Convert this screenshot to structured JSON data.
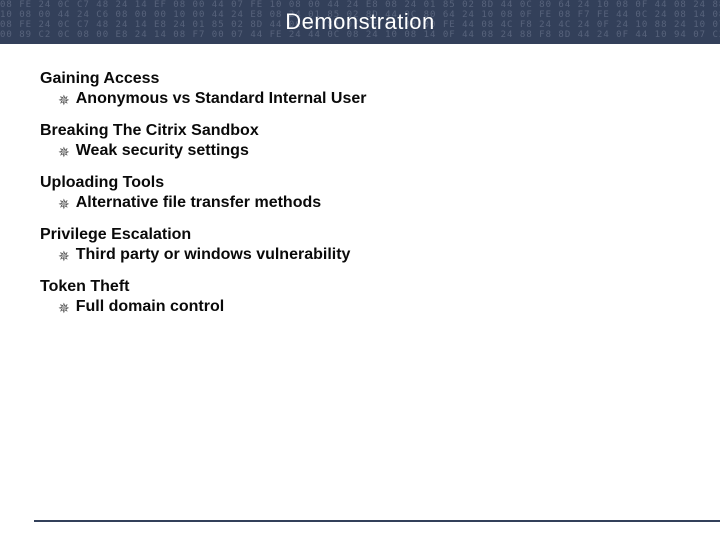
{
  "title": "Demonstration",
  "sections": [
    {
      "heading": "Gaining Access",
      "bullet": "Anonymous vs Standard Internal User"
    },
    {
      "heading": "Breaking The Citrix Sandbox",
      "bullet": "Weak security settings"
    },
    {
      "heading": "Uploading Tools",
      "bullet": "Alternative file transfer methods"
    },
    {
      "heading": "Privilege Escalation",
      "bullet": "Third party or windows vulnerability"
    },
    {
      "heading": "Token Theft",
      "bullet": "Full domain control"
    }
  ],
  "bullet_glyph": "✵"
}
